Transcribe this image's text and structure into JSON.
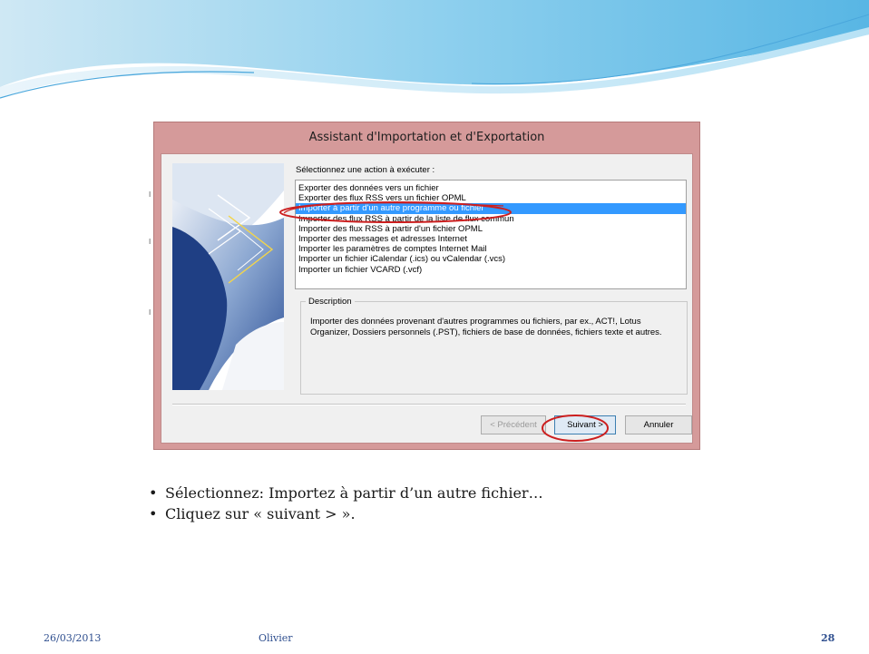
{
  "dialog": {
    "title": "Assistant d'Importation et d'Exportation",
    "prompt": "Sélectionnez une action à exécuter :",
    "actions": [
      "Exporter des données vers un fichier",
      "Exporter des flux RSS vers un fichier OPML",
      "Importer à partir d'un autre programme ou fichier",
      "Importer des flux RSS à partir de la liste de flux commun",
      "Importer des flux RSS à partir d'un fichier OPML",
      "Importer des messages et adresses Internet",
      "Importer les paramètres de comptes Internet Mail",
      "Importer un fichier iCalendar (.ics) ou vCalendar (.vcs)",
      "Importer un fichier VCARD (.vcf)"
    ],
    "selected_index": 2,
    "description_label": "Description",
    "description_text": "Importer des données provenant d'autres programmes ou fichiers, par ex., ACT!, Lotus Organizer, Dossiers personnels (.PST), fichiers de base de données, fichiers texte et autres.",
    "buttons": {
      "previous": "< Précédent",
      "next": "Suivant >",
      "cancel": "Annuler"
    }
  },
  "bullets": [
    "Sélectionnez: Importez à partir d’un autre fichier…",
    "Cliquez sur « suivant > »."
  ],
  "bullet_glyph": "•",
  "footer": {
    "date": "26/03/2013",
    "author": "Olivier",
    "page": "28"
  },
  "colors": {
    "dialog_frame": "#d59a9a",
    "selection": "#3399ff",
    "annotation": "#cc1f1f",
    "footer_text": "#2f4f8f"
  }
}
